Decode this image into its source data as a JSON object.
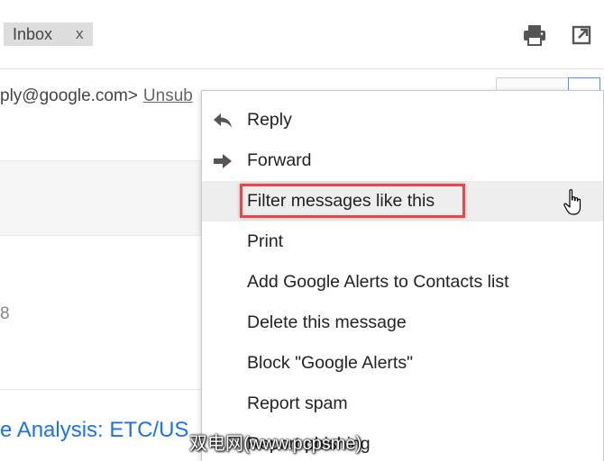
{
  "header": {
    "label_chip": {
      "text": "Inbox",
      "close": "x"
    },
    "print_icon": "printer-icon",
    "new_window_icon": "open-in-new-window-icon"
  },
  "email": {
    "sender_fragment": "ply@google.com>",
    "unsubscribe": "Unsub",
    "date_fragment": "8",
    "subject_fragment": "e Analysis: ETC/US"
  },
  "context_menu": {
    "items": [
      {
        "label": "Reply",
        "icon": "reply-arrow-icon"
      },
      {
        "label": "Forward",
        "icon": "forward-arrow-icon"
      },
      {
        "label": "Filter messages like this",
        "highlighted": true
      },
      {
        "label": "Print"
      },
      {
        "label": "Add Google Alerts to Contacts list"
      },
      {
        "label": "Delete this message"
      },
      {
        "label": "Block \"Google Alerts\""
      },
      {
        "label": "Report spam"
      },
      {
        "label": "Report phishing"
      }
    ]
  },
  "watermark": "双电网(www.pcpsme)",
  "colors": {
    "highlight_border": "#e8474a",
    "link_blue": "#1a73e8",
    "hover_bg": "#eeeeee"
  }
}
